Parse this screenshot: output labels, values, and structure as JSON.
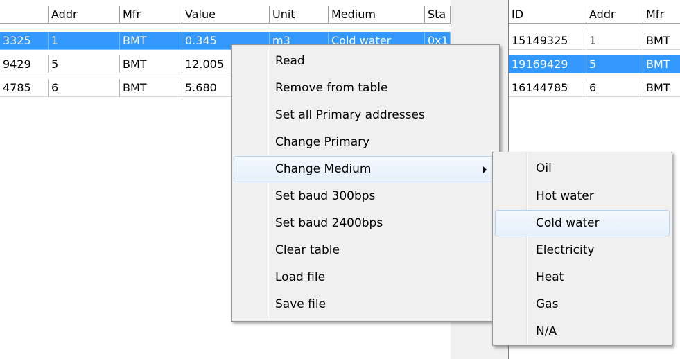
{
  "left_table": {
    "columns": [
      "",
      "Addr",
      "Mfr",
      "Value",
      "Unit",
      "Medium",
      "Sta"
    ],
    "rows": [
      {
        "id": "3325",
        "addr": "1",
        "mfr": "BMT",
        "value": "0.345",
        "unit": "m3",
        "medium": "Cold water",
        "status": "0x1",
        "selected": true
      },
      {
        "id": "9429",
        "addr": "5",
        "mfr": "BMT",
        "value": "12.005",
        "unit": "",
        "medium": "",
        "status": "",
        "selected": false
      },
      {
        "id": "4785",
        "addr": "6",
        "mfr": "BMT",
        "value": "5.680",
        "unit": "",
        "medium": "",
        "status": "",
        "selected": false
      }
    ]
  },
  "right_table": {
    "columns": [
      "ID",
      "Addr",
      "Mfr"
    ],
    "rows": [
      {
        "id": "15149325",
        "addr": "1",
        "mfr": "BMT",
        "selected": false
      },
      {
        "id": "19169429",
        "addr": "5",
        "mfr": "BMT",
        "selected": true
      },
      {
        "id": "16144785",
        "addr": "6",
        "mfr": "BMT",
        "selected": false
      }
    ]
  },
  "context_menu": {
    "items": [
      "Read",
      "Remove from table",
      "Set all Primary addresses",
      "Change Primary",
      "Change Medium",
      "Set baud 300bps",
      "Set baud 2400bps",
      "Clear table",
      "Load file",
      "Save file"
    ],
    "highlighted": "Change Medium"
  },
  "submenu": {
    "items": [
      "Oil",
      "Hot water",
      "Cold water",
      "Electricity",
      "Heat",
      "Gas",
      "N/A"
    ],
    "highlighted": "Cold water"
  },
  "colors": {
    "selection": "#3399ff",
    "menu_bg": "#f0f0f0",
    "menu_highlight_border": "#b7d2ef"
  }
}
